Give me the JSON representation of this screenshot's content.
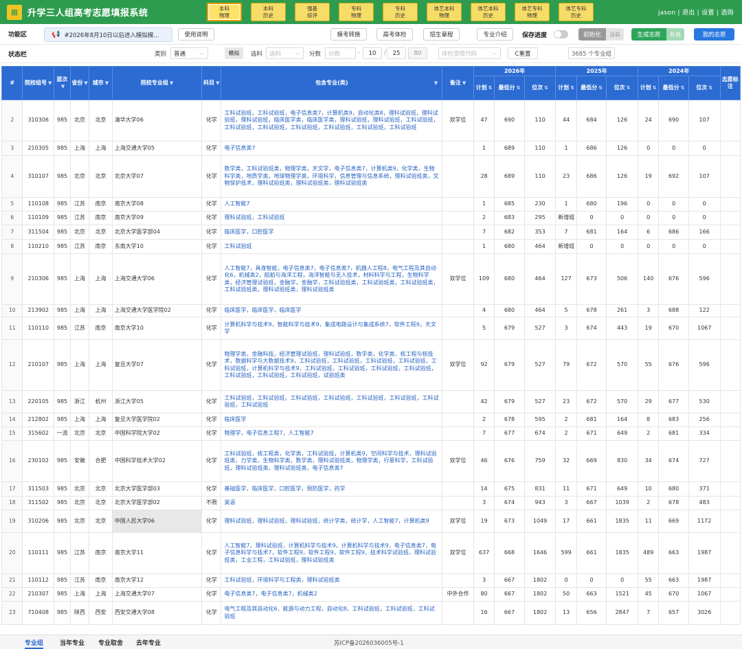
{
  "app": {
    "title": "升学三人组高考志愿填报系统",
    "user_text": "jason | 退出 | 设置 | 选购"
  },
  "modes": [
    "本科\n物理",
    "本科\n历史",
    "强基\n综评",
    "专科\n物理",
    "专科\n历史",
    "体艺本科\n物理",
    "体艺本科\n历史",
    "体艺专科\n物理",
    "体艺专科\n历史"
  ],
  "func": {
    "label": "功能区",
    "notice": "#2026年8月10日以后进入模拟模...",
    "manual": "使用说明",
    "mock_convert": "模考转换",
    "exam_check": "高考体检",
    "charter": "招生章程",
    "major_intro": "专业介绍",
    "save_progress": "保存进度",
    "init": "初始化",
    "current": "当前",
    "generate": "生成志愿",
    "supplement": "补充",
    "my_wish": "我的志愿"
  },
  "status": {
    "label": "状态栏",
    "category_label": "类别",
    "category_value": "普通",
    "mock": "模拟",
    "subject_label": "选科",
    "subject_placeholder": "选科",
    "score_label": "分数",
    "score_placeholder": "分数",
    "range_sep": "-",
    "range_from": "10",
    "slash": "/",
    "range_to": "25",
    "range_count": "80",
    "physical_placeholder": "体检受限代码",
    "reset": "C重置",
    "count": "3685 个专业组"
  },
  "headers": {
    "index": "#",
    "group_code": "院校组号",
    "level": "层次",
    "province": "省份",
    "city": "城市",
    "school_group": "院校专业组",
    "subject": "科目",
    "majors": "包含专业(类)",
    "remark": "备注",
    "y2026": "2026年",
    "y2025": "2025年",
    "y2024": "2024年",
    "plan": "计划",
    "min_score": "最低分",
    "rank": "位次",
    "wish_mark": "志愿标注"
  },
  "rows": [
    {
      "n": "2",
      "code": "310306",
      "lvl": "985",
      "prov": "北京",
      "city": "北京",
      "sch": "清华大学06",
      "subj": "化学",
      "maj": "工科试验班，工科试验班，电子信息类7，计算机类9，自动化类8，理科试验班，理科试验班，理科试验班，临床医学类，临床医学类，理科试验班，理科试验班，工科试验班，工科试验班，工科试验班，工科试验班，工科试验班，工科试验班，工科试验班",
      "rm": "双学位",
      "p26": "47",
      "m26": "690",
      "r26": "110",
      "p25": "44",
      "m25": "684",
      "r25": "126",
      "p24": "24",
      "m24": "690",
      "r24": "107",
      "h": 60
    },
    {
      "n": "3",
      "code": "210305",
      "lvl": "985",
      "prov": "上海",
      "city": "上海",
      "sch": "上海交通大学05",
      "subj": "化学",
      "maj": "电子信息类7",
      "rm": "",
      "p26": "1",
      "m26": "689",
      "r26": "110",
      "p25": "1",
      "m25": "686",
      "r25": "126",
      "p24": "0",
      "m24": "0",
      "r24": "0",
      "h": 21
    },
    {
      "n": "4",
      "code": "310107",
      "lvl": "985",
      "prov": "北京",
      "city": "北京",
      "sch": "北京大学07",
      "subj": "化学",
      "maj": "数学类，工科试验班类，物理学类，天文学，电子信息类7，计算机类9，化学类，生物科学类，地质学类，地球物理学类，环境科学，信息管理与信息系统，理科试验班类，文物保护技术，理科试验班类，理科试验班类，理科试验班类",
      "rm": "",
      "p26": "28",
      "m26": "689",
      "r26": "110",
      "p25": "23",
      "m25": "686",
      "r25": "126",
      "p24": "19",
      "m24": "692",
      "r24": "107",
      "h": 61
    },
    {
      "n": "5",
      "code": "110108",
      "lvl": "985",
      "prov": "江苏",
      "city": "南京",
      "sch": "南京大学08",
      "subj": "化学",
      "maj": "人工智能7",
      "rm": "",
      "p26": "1",
      "m26": "685",
      "r26": "230",
      "p25": "1",
      "m25": "680",
      "r25": "196",
      "p24": "0",
      "m24": "0",
      "r24": "0",
      "h": 20
    },
    {
      "n": "6",
      "code": "110109",
      "lvl": "985",
      "prov": "江苏",
      "city": "南京",
      "sch": "南京大学09",
      "subj": "化学",
      "maj": "理科试验班，工科试验班",
      "rm": "",
      "p26": "2",
      "m26": "683",
      "r26": "295",
      "p25": "新增组",
      "m25": "0",
      "r25": "0",
      "p24": "0",
      "m24": "0",
      "r24": "0",
      "h": 20
    },
    {
      "n": "7",
      "code": "311504",
      "lvl": "985",
      "prov": "北京",
      "city": "北京",
      "sch": "北京大学医学部04",
      "subj": "化学",
      "maj": "临床医学，口腔医学",
      "rm": "",
      "p26": "7",
      "m26": "682",
      "r26": "353",
      "p25": "7",
      "m25": "681",
      "r25": "164",
      "p24": "6",
      "m24": "686",
      "r24": "166",
      "h": 21
    },
    {
      "n": "8",
      "code": "110210",
      "lvl": "985",
      "prov": "江苏",
      "city": "南京",
      "sch": "东南大学10",
      "subj": "化学",
      "maj": "工科试验班",
      "rm": "",
      "p26": "1",
      "m26": "680",
      "r26": "464",
      "p25": "新增组",
      "m25": "0",
      "r25": "0",
      "p24": "0",
      "m24": "0",
      "r24": "0",
      "h": 21
    },
    {
      "n": "9",
      "code": "210306",
      "lvl": "985",
      "prov": "上海",
      "city": "上海",
      "sch": "上海交通大学06",
      "subj": "化学",
      "maj": "人工智能7，具身智能，电子信息类7，电子信息类7，机器人工程8，电气工程及其自动化6，机械类2，船舶与海洋工程，海洋智能与无人技术，材料科学与工程，生物科学类，经济管理试验班，金融学，金融学，工科试验班类，工科试验班类，工科试验班类，工科试验班类，理科试验班类，理科试验班类",
      "rm": "双学位",
      "p26": "109",
      "m26": "680",
      "r26": "464",
      "p25": "127",
      "m25": "673",
      "r25": "506",
      "p24": "140",
      "m24": "676",
      "r24": "596",
      "h": 74
    },
    {
      "n": "10",
      "code": "213902",
      "lvl": "985",
      "prov": "上海",
      "city": "上海",
      "sch": "上海交通大学医学院02",
      "subj": "化学",
      "maj": "临床医学，临床医学，临床医学",
      "rm": "",
      "p26": "4",
      "m26": "680",
      "r26": "464",
      "p25": "5",
      "m25": "678",
      "r25": "261",
      "p24": "3",
      "m24": "688",
      "r24": "122",
      "h": 18
    },
    {
      "n": "11",
      "code": "110110",
      "lvl": "985",
      "prov": "江苏",
      "city": "南京",
      "sch": "南京大学10",
      "subj": "化学",
      "maj": "计算机科学与技术9，智能科学与技术9，集成电路设计与集成系统7，软件工程9，天文学",
      "rm": "",
      "p26": "5",
      "m26": "679",
      "r26": "527",
      "p25": "3",
      "m25": "674",
      "r25": "443",
      "p24": "19",
      "m24": "670",
      "r24": "1067",
      "h": 33
    },
    {
      "n": "12",
      "code": "210107",
      "lvl": "985",
      "prov": "上海",
      "city": "上海",
      "sch": "复旦大学07",
      "subj": "化学",
      "maj": "物理学类，金融科技，经济管理试验班，理科试验班，数学类，化学类，核工程与核技术，数据科学与大数据技术9，工科试验班，工科试验班，工科试验班，工科试验班，工科试验班，计算机科学与技术9，工科试验班，工科试验班，工科试验班，工科试验班，工科试验班，工科试验班，工科试验班，试验班类",
      "rm": "双学位",
      "p26": "92",
      "m26": "679",
      "r26": "527",
      "p25": "79",
      "m25": "672",
      "r25": "570",
      "p24": "55",
      "m24": "676",
      "r24": "596",
      "h": 74
    },
    {
      "n": "13",
      "code": "220105",
      "lvl": "985",
      "prov": "浙江",
      "city": "杭州",
      "sch": "浙江大学05",
      "subj": "化学",
      "maj": "工科试验班，工科试验班，工科试验班，工科试验班，工科试验班，工科试验班，工科试验班，工科试验班",
      "rm": "",
      "p26": "42",
      "m26": "679",
      "r26": "527",
      "p25": "23",
      "m25": "672",
      "r25": "570",
      "p24": "29",
      "m24": "677",
      "r24": "530",
      "h": 33
    },
    {
      "n": "14",
      "code": "212802",
      "lvl": "985",
      "prov": "上海",
      "city": "上海",
      "sch": "复旦大学医学院02",
      "subj": "化学",
      "maj": "临床医学",
      "rm": "",
      "p26": "2",
      "m26": "678",
      "r26": "595",
      "p25": "2",
      "m25": "681",
      "r25": "164",
      "p24": "8",
      "m24": "683",
      "r24": "256",
      "h": 20
    },
    {
      "n": "15",
      "code": "315602",
      "lvl": "一流",
      "prov": "北京",
      "city": "北京",
      "sch": "中国科学院大学02",
      "subj": "化学",
      "maj": "物理学，电子信息工程7，人工智能7",
      "rm": "",
      "p26": "7",
      "m26": "677",
      "r26": "674",
      "p25": "2",
      "m25": "671",
      "r25": "649",
      "p24": "2",
      "m24": "681",
      "r24": "334",
      "h": 20
    },
    {
      "n": "16",
      "code": "230102",
      "lvl": "985",
      "prov": "安徽",
      "city": "合肥",
      "sch": "中国科学技术大学02",
      "subj": "化学",
      "maj": "工科试验班，核工程类，化学类，工科试验班，计算机类9，空间科学与技术，理科试验班类，力学类，生物科学类，数学类，理科试验班类，物理学类，行星科学，工科试验班，理科试验班类，理科试验班类，电子信息类7",
      "rm": "双学位",
      "p26": "46",
      "m26": "676",
      "r26": "759",
      "p25": "32",
      "m25": "669",
      "r25": "830",
      "p24": "34",
      "m24": "674",
      "r24": "727",
      "h": 60
    },
    {
      "n": "17",
      "code": "311503",
      "lvl": "985",
      "prov": "北京",
      "city": "北京",
      "sch": "北京大学医学部03",
      "subj": "化学",
      "maj": "基础医学，临床医学，口腔医学，预防医学，药学",
      "rm": "",
      "p26": "14",
      "m26": "675",
      "r26": "831",
      "p25": "11",
      "m25": "671",
      "r25": "649",
      "p24": "10",
      "m24": "680",
      "r24": "371",
      "h": 21
    },
    {
      "n": "18",
      "code": "311502",
      "lvl": "985",
      "prov": "北京",
      "city": "北京",
      "sch": "北京大学医学部02",
      "subj": "不限",
      "maj": "英语",
      "rm": "",
      "p26": "3",
      "m26": "674",
      "r26": "943",
      "p25": "3",
      "m25": "667",
      "r25": "1039",
      "p24": "2",
      "m24": "678",
      "r24": "483",
      "h": 20
    },
    {
      "n": "19",
      "code": "310206",
      "lvl": "985",
      "prov": "北京",
      "city": "北京",
      "sch": "中国人民大学06",
      "subj": "化学",
      "maj": "理科试验班，理科试验班，理科试验班，统计学类，统计学，人工智能7，计算机类9",
      "rm": "双学位",
      "p26": "19",
      "m26": "673",
      "r26": "1049",
      "p25": "17",
      "m25": "661",
      "r25": "1835",
      "p24": "11",
      "m24": "669",
      "r24": "1172",
      "h": 33,
      "hl": true
    },
    {
      "n": "20",
      "code": "110111",
      "lvl": "985",
      "prov": "江苏",
      "city": "南京",
      "sch": "南京大学11",
      "subj": "化学",
      "maj": "人工智能7，理科试验班，计算机科学与技术9，计算机科学与技术9，电子信息类7，电子信息科学与技术7，软件工程9，软件工程9，软件工程9，技术科学试验班，理科试验班类，工业工程，工科试验班，理科试验班类",
      "rm": "双学位",
      "p26": "637",
      "m26": "668",
      "r26": "1646",
      "p25": "599",
      "m25": "661",
      "r25": "1835",
      "p24": "489",
      "m24": "663",
      "r24": "1987",
      "h": 60
    },
    {
      "n": "21",
      "code": "110112",
      "lvl": "985",
      "prov": "江苏",
      "city": "南京",
      "sch": "南京大学12",
      "subj": "化学",
      "maj": "工科试验班，环境科学与工程类，理科试验班类",
      "rm": "",
      "p26": "3",
      "m26": "667",
      "r26": "1802",
      "p25": "0",
      "m25": "0",
      "r25": "0",
      "p24": "55",
      "m24": "663",
      "r24": "1987",
      "h": 20
    },
    {
      "n": "22",
      "code": "210307",
      "lvl": "985",
      "prov": "上海",
      "city": "上海",
      "sch": "上海交通大学07",
      "subj": "化学",
      "maj": "电子信息类7，电子信息类7，机械类2",
      "rm": "中外合作",
      "p26": "80",
      "m26": "667",
      "r26": "1802",
      "p25": "50",
      "m25": "663",
      "r25": "1521",
      "p24": "45",
      "m24": "670",
      "r24": "1067",
      "h": 20
    },
    {
      "n": "23",
      "code": "710408",
      "lvl": "985",
      "prov": "陕西",
      "city": "西安",
      "sch": "西安交通大学08",
      "subj": "化学",
      "maj": "电气工程及其自动化6，能源与动力工程，自动化8，工科试验班，工科试验班，工科试验班",
      "rm": "",
      "p26": "16",
      "m26": "667",
      "r26": "1802",
      "p25": "13",
      "m25": "656",
      "r25": "2847",
      "p24": "7",
      "m24": "657",
      "r24": "3026",
      "h": 34
    }
  ],
  "bottom": {
    "tabs": [
      "专业组",
      "当年专业",
      "专业取舍",
      "去年专业"
    ],
    "icp": "苏ICP备2026036005号-1"
  }
}
